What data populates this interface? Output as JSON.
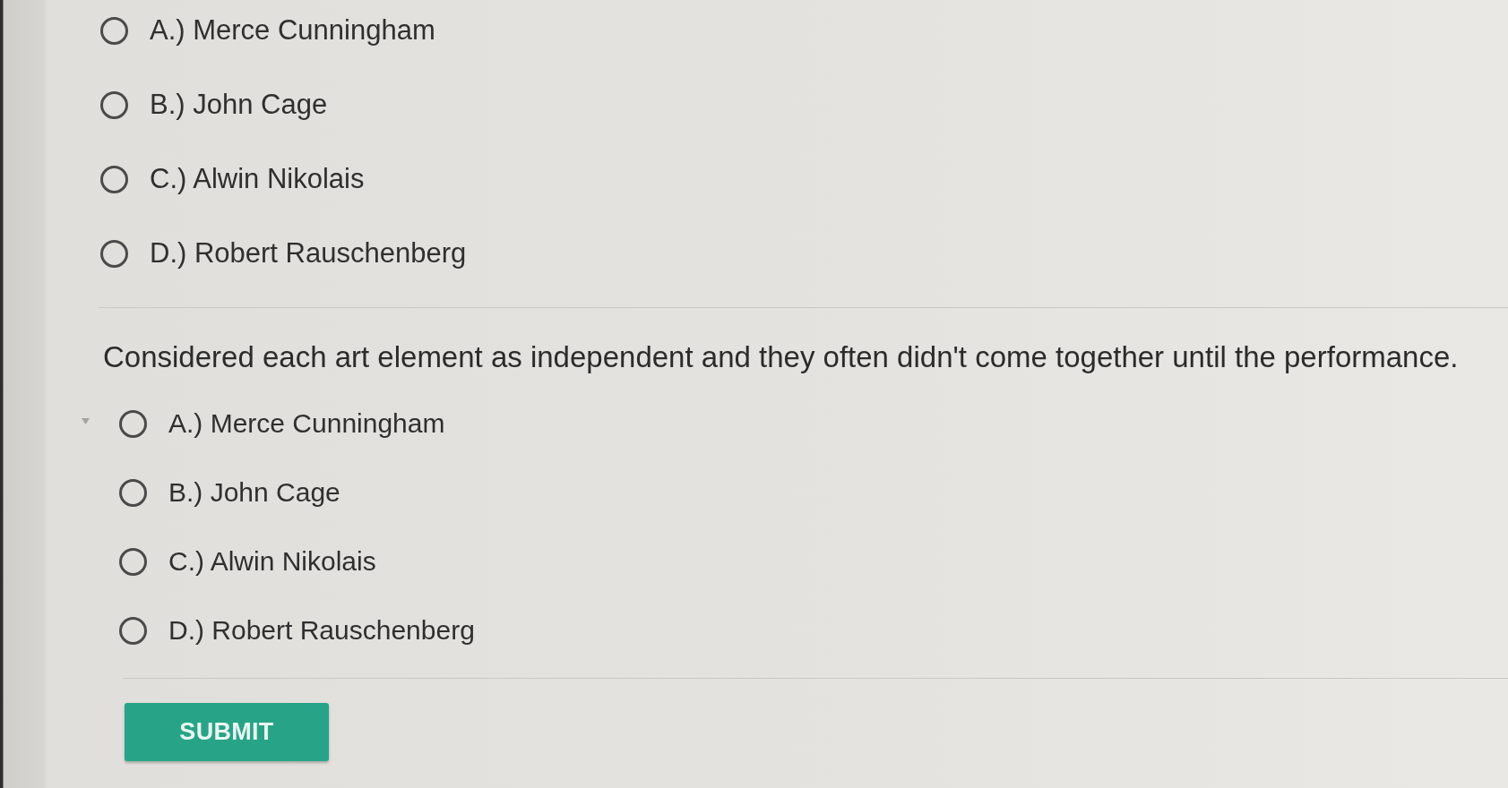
{
  "questions": [
    {
      "options": [
        {
          "label": "A.) Merce Cunningham",
          "selected": false
        },
        {
          "label": "B.) John Cage",
          "selected": false
        },
        {
          "label": "C.) Alwin Nikolais",
          "selected": false
        },
        {
          "label": "D.) Robert Rauschenberg",
          "selected": false
        }
      ]
    },
    {
      "prompt": "Considered each art element as independent and they often didn't come together until the performance.",
      "options": [
        {
          "label": "A.) Merce Cunningham",
          "selected": false
        },
        {
          "label": "B.) John Cage",
          "selected": false
        },
        {
          "label": "C.) Alwin Nikolais",
          "selected": false
        },
        {
          "label": "D.) Robert Rauschenberg",
          "selected": false
        }
      ]
    }
  ],
  "submit_button": {
    "label": "SUBMIT"
  }
}
